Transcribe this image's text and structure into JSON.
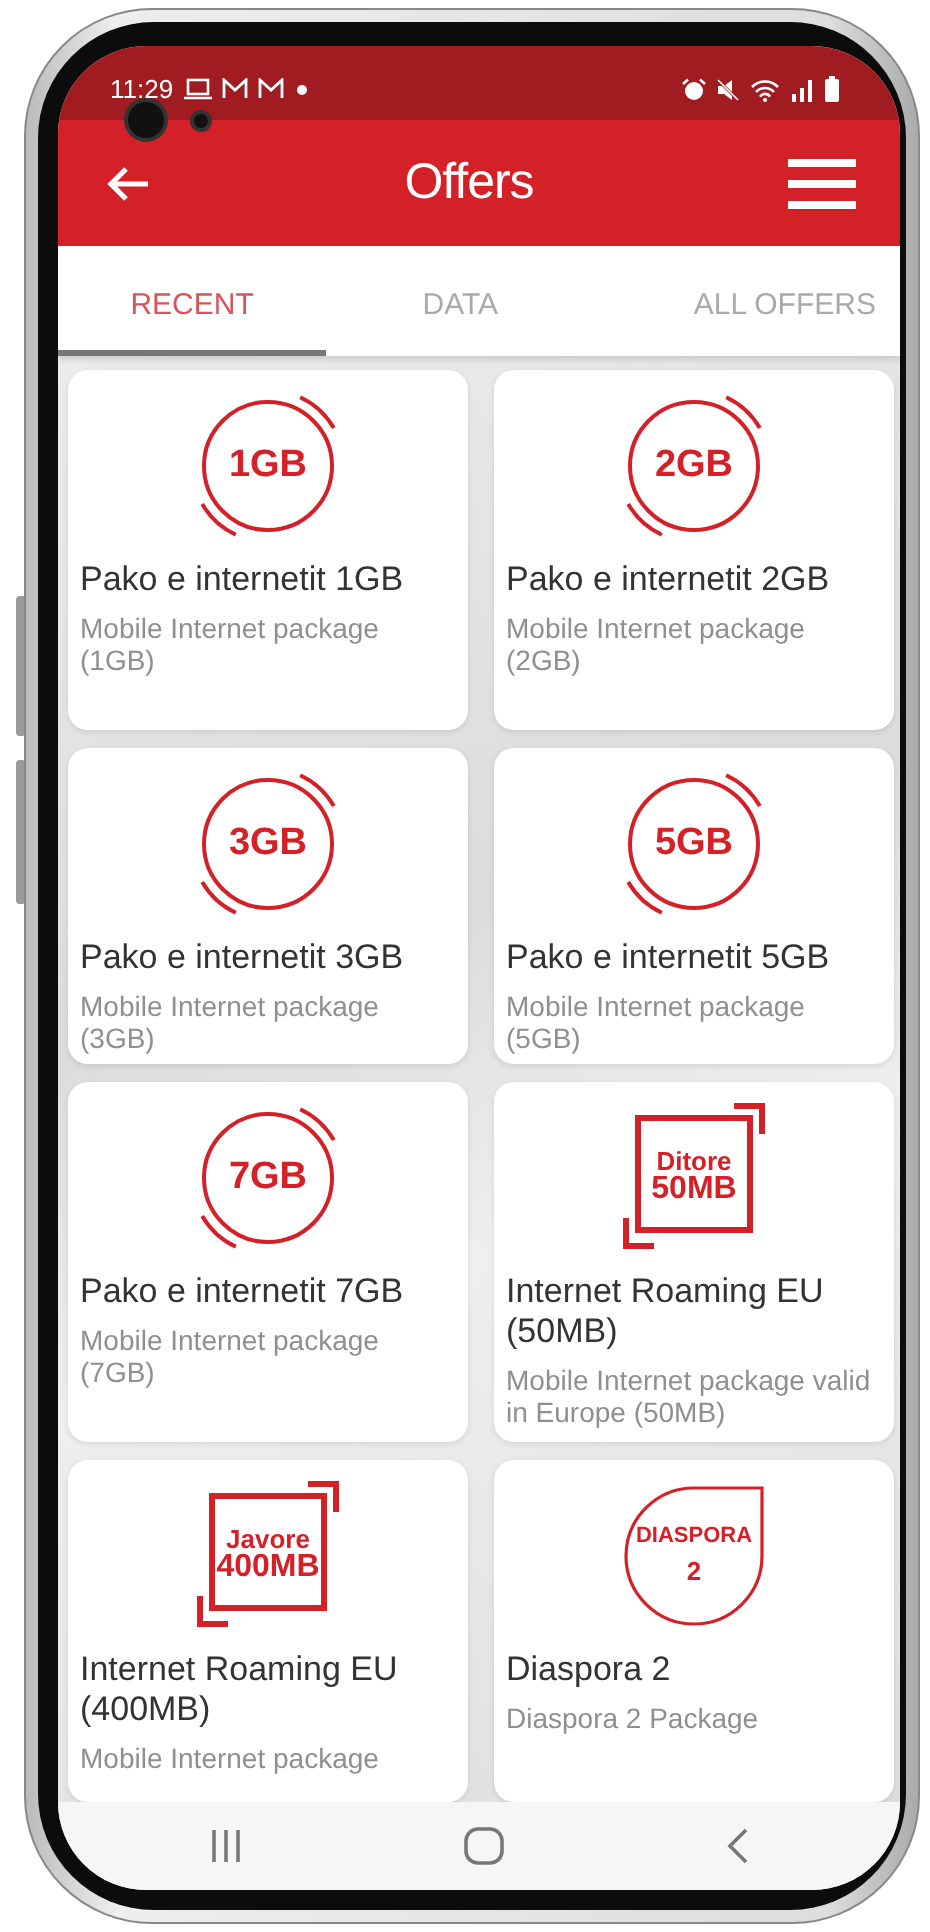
{
  "status_bar": {
    "time": "11:29"
  },
  "app_bar": {
    "title": "Offers"
  },
  "tabs": [
    {
      "label": "RECENT",
      "selected": true
    },
    {
      "label": "DATA",
      "selected": false
    },
    {
      "label": "ALL OFFERS",
      "selected": false
    }
  ],
  "offers": [
    {
      "kind": "ring",
      "badge": [
        "1GB"
      ],
      "title": "Pako e internetit 1GB",
      "subtitle": "Mobile Internet package (1GB)"
    },
    {
      "kind": "ring",
      "badge": [
        "2GB"
      ],
      "title": "Pako e internetit 2GB",
      "subtitle": "Mobile Internet package (2GB)"
    },
    {
      "kind": "ring",
      "badge": [
        "3GB"
      ],
      "title": "Pako e internetit 3GB",
      "subtitle": "Mobile Internet package (3GB)"
    },
    {
      "kind": "ring",
      "badge": [
        "5GB"
      ],
      "title": "Pako e internetit 5GB",
      "subtitle": "Mobile Internet package (5GB)"
    },
    {
      "kind": "ring",
      "badge": [
        "7GB"
      ],
      "title": "Pako e internetit 7GB",
      "subtitle": "Mobile Internet package (7GB)"
    },
    {
      "kind": "square",
      "badge": [
        "Ditore",
        "50MB"
      ],
      "title": "Internet Roaming EU (50MB)",
      "subtitle": "Mobile Internet package valid in Europe (50MB)"
    },
    {
      "kind": "square",
      "badge": [
        "Javore",
        "400MB"
      ],
      "title": "Internet Roaming EU (400MB)",
      "subtitle": "Mobile Internet package"
    },
    {
      "kind": "drop",
      "badge": [
        "DIASPORA",
        "2"
      ],
      "title": "Diaspora 2",
      "subtitle": "Diaspora 2 Package"
    }
  ]
}
